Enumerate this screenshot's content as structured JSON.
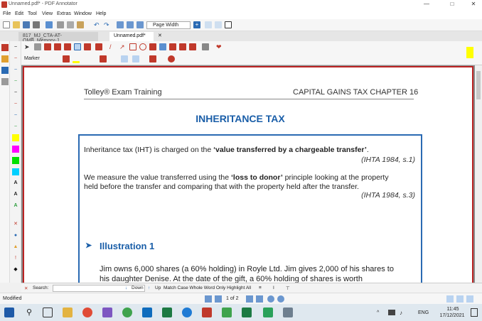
{
  "window": {
    "title": "Unnamed.pdf* - PDF Annotator"
  },
  "menu": [
    "File",
    "Edit",
    "Tool",
    "View",
    "Extras",
    "Window",
    "Help"
  ],
  "toolbar": {
    "zoom_value": "Page Width"
  },
  "tabs": [
    {
      "label": "817_MJ_CTA-AT-OMB_Memory-J..."
    },
    {
      "label": "Unnamed.pdf*"
    }
  ],
  "tool_options": {
    "tool_name": "Marker"
  },
  "document": {
    "header_left": "Tolley® Exam Training",
    "header_right": "CAPITAL GAINS TAX  CHAPTER  16",
    "title": "INHERITANCE TAX",
    "para1_prefix": "Inheritance tax (IHT) is charged on the ",
    "para1_bold": "‘value transferred by a chargeable transfer’",
    "para1_suffix": ".",
    "ref1": "(IHTA 1984, s.1)",
    "para2_prefix": "We measure the value transferred using the ",
    "para2_bold": "‘loss to donor’",
    "para2_suffix": " principle looking at the property",
    "para2_line2": "held before the transfer and comparing that with the property held after the transfer.",
    "ref2": "(IHTA 1984, s.3)",
    "illustration_title": "Illustration 1",
    "ill_line1": "Jim owns 6,000 shares (a 60% holding) in Royle Ltd. Jim gives 2,000 of his shares to",
    "ill_line2": "his daughter Denise. At the date of the gift, a 60% holding of shares is worth"
  },
  "search": {
    "label": "Search:",
    "down": "Down",
    "up": "Up",
    "options": "Match Case  Whole Word Only  Highlight All"
  },
  "status": {
    "text": "Modified",
    "page_indicator": "1 of 2"
  },
  "taskbar": {
    "language": "ENG",
    "time": "11:45",
    "date": "17/12/2021"
  },
  "colors": {
    "accent_blue": "#1a5ea8",
    "box_border": "#2a6ab3",
    "page_border": "#b22222",
    "highlighter_yellow": "#ffff00"
  }
}
